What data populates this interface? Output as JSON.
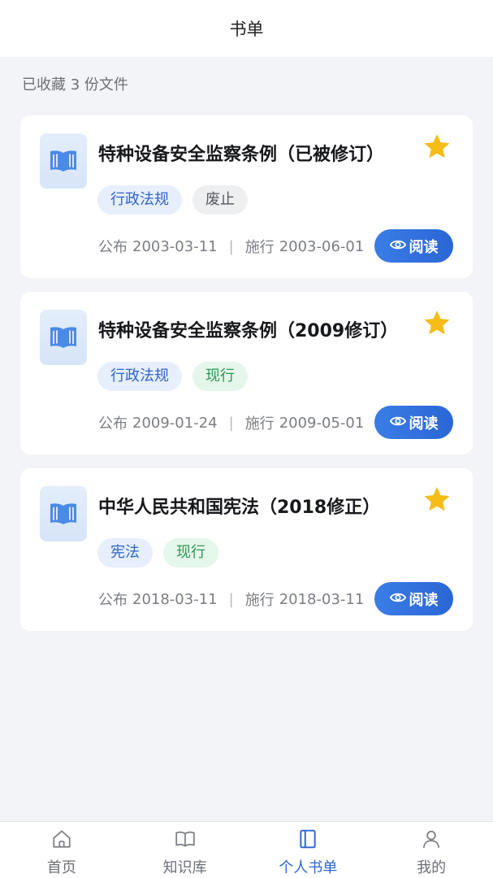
{
  "header": {
    "title": "书单"
  },
  "summary": {
    "count_text": "已收藏 3 份文件"
  },
  "colors": {
    "accent": "#2a66d6",
    "star": "#f6bd16",
    "tag_type_bg": "#e7effd",
    "tag_current_bg": "#e5f6ea",
    "tag_abolished_bg": "#eeeff1"
  },
  "items": [
    {
      "title": "特种设备安全监察条例（已被修订）",
      "tags": [
        "行政法规",
        "废止"
      ],
      "publish_label": "公布",
      "publish_date": "2003-03-11",
      "effective_label": "施行",
      "effective_date": "2003-06-01",
      "read_label": "阅读"
    },
    {
      "title": "特种设备安全监察条例（2009修订）",
      "tags": [
        "行政法规",
        "现行"
      ],
      "publish_label": "公布",
      "publish_date": "2009-01-24",
      "effective_label": "施行",
      "effective_date": "2009-05-01",
      "read_label": "阅读"
    },
    {
      "title": "中华人民共和国宪法（2018修正）",
      "tags": [
        "宪法",
        "现行"
      ],
      "publish_label": "公布",
      "publish_date": "2018-03-11",
      "effective_label": "施行",
      "effective_date": "2018-03-11",
      "read_label": "阅读"
    }
  ],
  "tabbar": {
    "tabs": [
      {
        "label": "首页",
        "icon": "home-icon"
      },
      {
        "label": "知识库",
        "icon": "book-open-icon"
      },
      {
        "label": "个人书单",
        "icon": "booklist-icon"
      },
      {
        "label": "我的",
        "icon": "user-icon"
      }
    ],
    "active_index": 2
  }
}
